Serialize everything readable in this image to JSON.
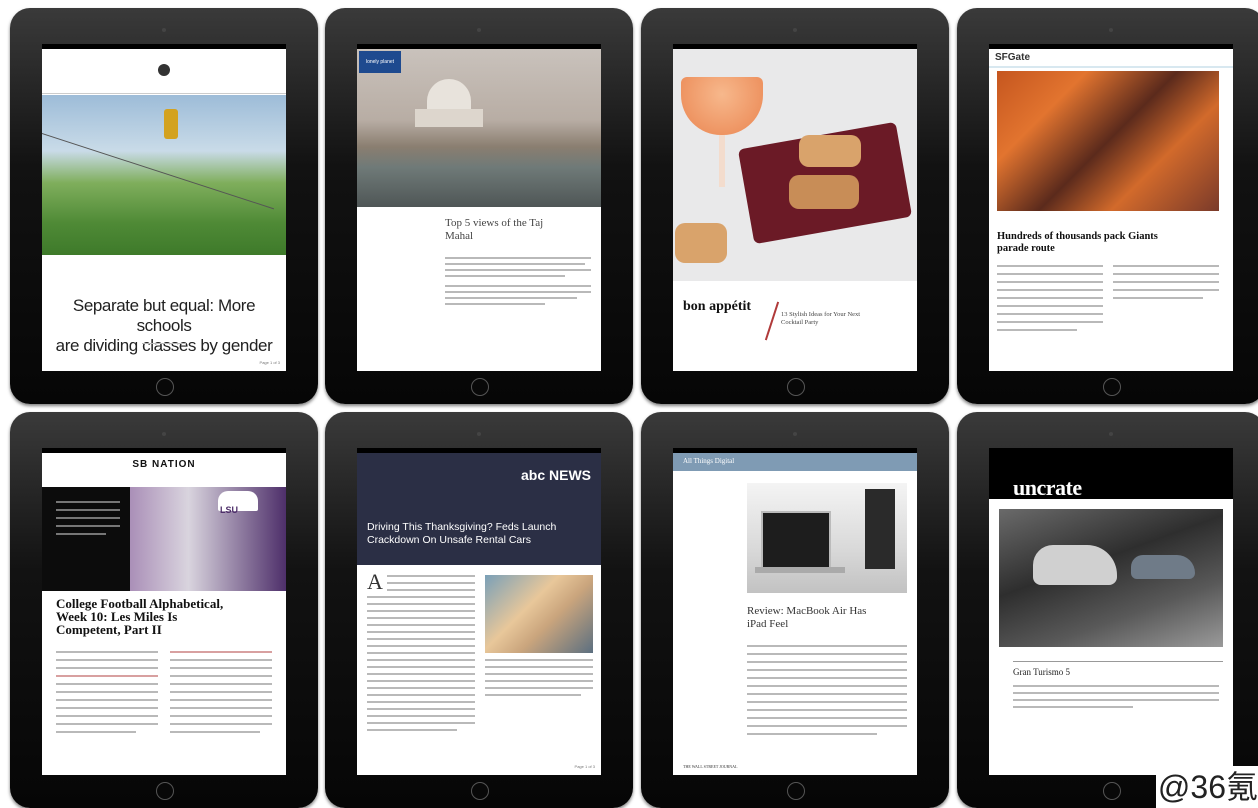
{
  "devices": {
    "d1": {
      "headline_l1": "Separate but equal: More schools",
      "headline_l2": "are dividing classes by gender",
      "page": "Page 1 of 3"
    },
    "d2": {
      "badge": "lonely planet",
      "title_l1": "Top 5 views of the Taj",
      "title_l2": "Mahal"
    },
    "d3": {
      "brand": "bon appétit",
      "headline_l1": "13 Stylish Ideas for Your Next",
      "headline_l2": "Cocktail Party"
    },
    "d4": {
      "brand": "SFGate",
      "headline_l1": "Hundreds of thousands pack Giants",
      "headline_l2": "parade route"
    },
    "d5": {
      "brand": "SB NATION",
      "photo_caption": "LSU",
      "headline_l1": "College Football Alphabetical,",
      "headline_l2": "Week 10: Les Miles Is",
      "headline_l3": "Competent, Part II"
    },
    "d6": {
      "brand": "abc NEWS",
      "headline_l1": "Driving This Thanksgiving? Feds Launch",
      "headline_l2": "Crackdown On Unsafe Rental Cars",
      "dropcap": "A",
      "page": "Page 1 of 3"
    },
    "d7": {
      "brand": "All Things Digital",
      "headline_l1": "Review: MacBook Air Has",
      "headline_l2": "iPad Feel",
      "footer": "THE WALL STREET JOURNAL"
    },
    "d8": {
      "brand": "uncrate",
      "headline": "Gran Turismo 5"
    }
  },
  "watermark": "@36氪",
  "colors": {
    "bezel": "#0a0a0a",
    "abc_band": "#2b2f45",
    "atd_bar": "#7f9bb4",
    "bon_wine": "#6b1a26"
  }
}
